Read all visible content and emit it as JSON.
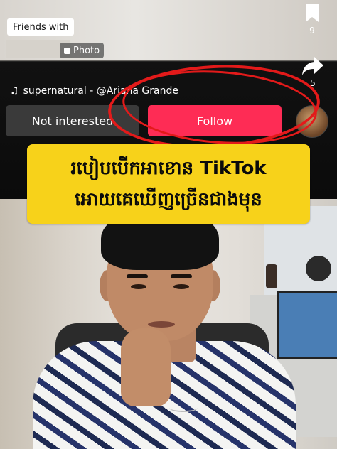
{
  "chip": {
    "friends_label": "Friends with"
  },
  "photo_badge": {
    "label": "Photo"
  },
  "sidebar": {
    "bookmark_count": "9",
    "share_count": "5"
  },
  "music": {
    "label": "supernatural - @Ariana Grande"
  },
  "actions": {
    "not_interested_label": "Not interested",
    "follow_label": "Follow"
  },
  "banner": {
    "line1": "របៀបបើកអាខោន TikTok",
    "line2": "អោយគេឃើញច្រើនជាងមុន"
  },
  "colors": {
    "follow": "#fe2c55",
    "banner": "#f7d21a",
    "annotation": "#e31a1a"
  },
  "icons": [
    "bookmark-icon",
    "share-icon",
    "music-note-icon",
    "photo-icon"
  ]
}
